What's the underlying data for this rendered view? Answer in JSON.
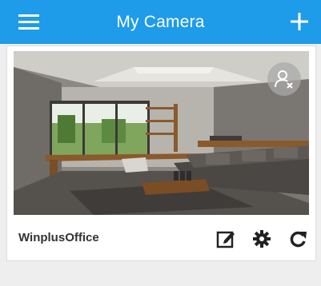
{
  "header": {
    "title": "My Camera",
    "menu_icon": "hamburger-menu-icon",
    "add_icon": "plus-icon",
    "background_color": "#1e9be9"
  },
  "camera_card": {
    "name": "WinplusOffice",
    "preview_description": "live-preview-snapshot",
    "overlay_icon": "user-x-icon",
    "actions": [
      {
        "name": "edit",
        "icon": "edit-icon"
      },
      {
        "name": "settings",
        "icon": "gear-icon"
      },
      {
        "name": "refresh",
        "icon": "refresh-icon"
      }
    ]
  }
}
